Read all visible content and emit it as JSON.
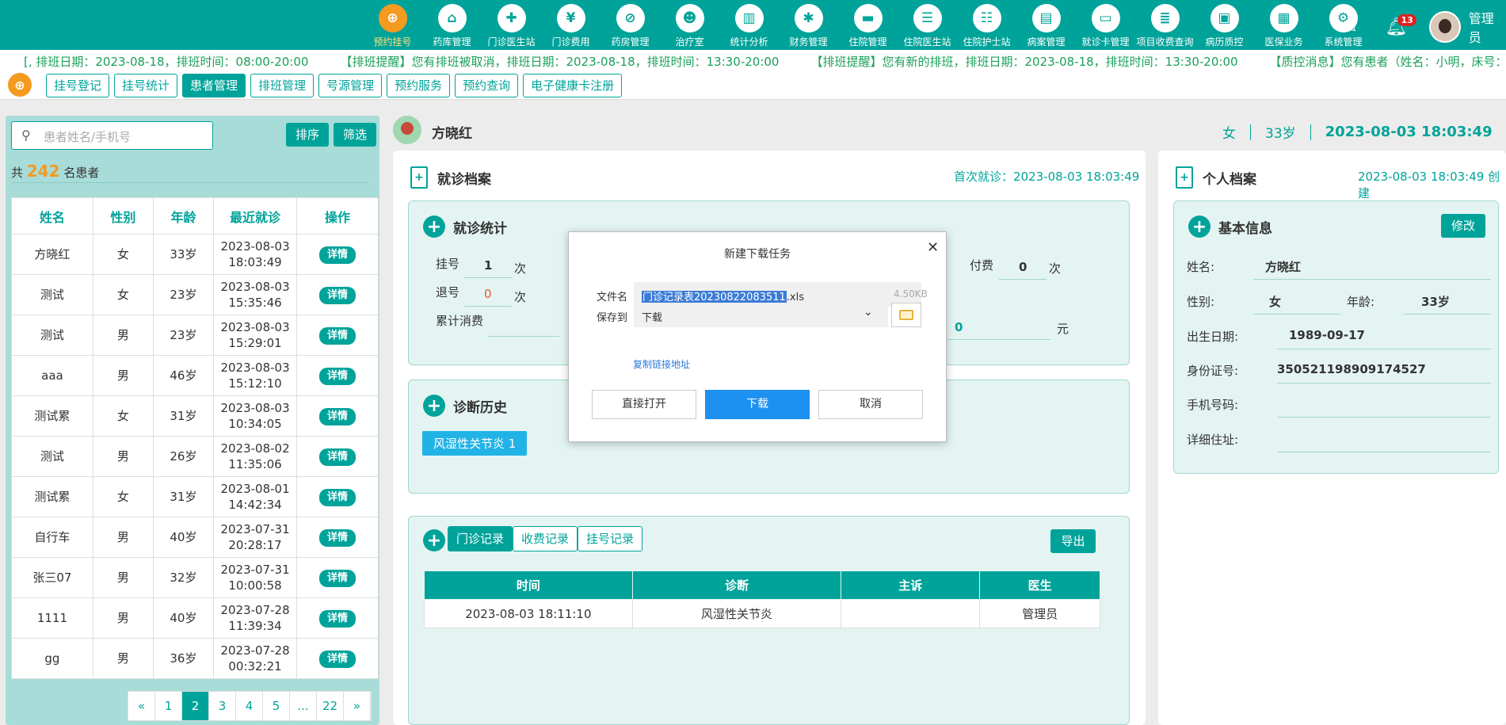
{
  "header": {
    "nav": [
      {
        "label": "预约挂号",
        "icon": "calendar-plus-icon",
        "glyph": "⊕"
      },
      {
        "label": "药库管理",
        "icon": "warehouse-icon",
        "glyph": "⌂"
      },
      {
        "label": "门诊医生站",
        "icon": "doctor-icon",
        "glyph": "✚"
      },
      {
        "label": "门诊费用",
        "icon": "yen-icon",
        "glyph": "¥"
      },
      {
        "label": "药房管理",
        "icon": "pill-icon",
        "glyph": "⊘"
      },
      {
        "label": "治疗室",
        "icon": "nurse-icon",
        "glyph": "☻"
      },
      {
        "label": "统计分析",
        "icon": "chart-icon",
        "glyph": "▥"
      },
      {
        "label": "财务管理",
        "icon": "gear-money-icon",
        "glyph": "✱"
      },
      {
        "label": "住院管理",
        "icon": "bed-icon",
        "glyph": "▬"
      },
      {
        "label": "住院医生站",
        "icon": "doctor-card-icon",
        "glyph": "☰"
      },
      {
        "label": "住院护士站",
        "icon": "nurse-card-icon",
        "glyph": "☷"
      },
      {
        "label": "病案管理",
        "icon": "folder-icon",
        "glyph": "▤"
      },
      {
        "label": "就诊卡管理",
        "icon": "card-icon",
        "glyph": "▭"
      },
      {
        "label": "项目收费查询",
        "icon": "receipt-icon",
        "glyph": "≣"
      },
      {
        "label": "病历质控",
        "icon": "record-icon",
        "glyph": "▣"
      },
      {
        "label": "医保业务",
        "icon": "insurance-icon",
        "glyph": "▦"
      },
      {
        "label": "系统管理",
        "icon": "settings-icon",
        "glyph": "⚙"
      }
    ],
    "notification_count": "13",
    "user_name": "管理员"
  },
  "ticker": [
    "[, 排班日期：2023-08-18，排班时间：08:00-20:00",
    "【排班提醒】您有排班被取消，排班日期：2023-08-18，排班时间：13:30-20:00",
    "【排班提醒】您有新的排班，排班日期：2023-08-18，排班时间：13:30-20:00",
    "【质控消息】您有患者（姓名：小明，床号：13）"
  ],
  "subtabs": [
    "挂号登记",
    "挂号统计",
    "患者管理",
    "排班管理",
    "号源管理",
    "预约服务",
    "预约查询",
    "电子健康卡注册"
  ],
  "left": {
    "search_placeholder": "患者姓名/手机号",
    "sort_label": "排序",
    "filter_label": "筛选",
    "count_prefix": "共",
    "count": "242",
    "count_suffix": "名患者",
    "columns": [
      "姓名",
      "性别",
      "年龄",
      "最近就诊",
      "操作"
    ],
    "detail_label": "详情",
    "rows": [
      {
        "name": "方晓红",
        "sex": "女",
        "age": "33岁",
        "date": "2023-08-03",
        "time": "18:03:49"
      },
      {
        "name": "测试",
        "sex": "女",
        "age": "23岁",
        "date": "2023-08-03",
        "time": "15:35:46"
      },
      {
        "name": "测试",
        "sex": "男",
        "age": "23岁",
        "date": "2023-08-03",
        "time": "15:29:01"
      },
      {
        "name": "aaa",
        "sex": "男",
        "age": "46岁",
        "date": "2023-08-03",
        "time": "15:12:10"
      },
      {
        "name": "测试累",
        "sex": "女",
        "age": "31岁",
        "date": "2023-08-03",
        "time": "10:34:05"
      },
      {
        "name": "测试",
        "sex": "男",
        "age": "26岁",
        "date": "2023-08-02",
        "time": "11:35:06"
      },
      {
        "name": "测试累",
        "sex": "女",
        "age": "31岁",
        "date": "2023-08-01",
        "time": "14:42:34"
      },
      {
        "name": "自行车",
        "sex": "男",
        "age": "40岁",
        "date": "2023-07-31",
        "time": "20:28:17"
      },
      {
        "name": "张三07",
        "sex": "男",
        "age": "32岁",
        "date": "2023-07-31",
        "time": "10:00:58"
      },
      {
        "name": "1111",
        "sex": "男",
        "age": "40岁",
        "date": "2023-07-28",
        "time": "11:39:34"
      },
      {
        "name": "gg",
        "sex": "男",
        "age": "36岁",
        "date": "2023-07-28",
        "time": "00:32:21"
      }
    ],
    "pager": [
      "«",
      "1",
      "2",
      "3",
      "4",
      "5",
      "...",
      "22",
      "»"
    ],
    "current_page": "2"
  },
  "patient": {
    "name": "方晓红",
    "sex": "女",
    "age": "33岁",
    "datetime": "2023-08-03 18:03:49"
  },
  "visit": {
    "title": "就诊档案",
    "first_visit": "首次就诊：2023-08-03 18:03:49",
    "stats_title": "就诊统计",
    "reg_label": "挂号",
    "reg_value": "1",
    "unit_times": "次",
    "refund_label": "退号",
    "refund_value": "0",
    "total_label": "累计消费",
    "paid_label": "付费",
    "paid_value": "0",
    "amount_value": "0",
    "unit_yuan": "元",
    "history_title": "诊断历史",
    "history_chip": "风湿性关节炎   1",
    "record_tabs": [
      "门诊记录",
      "收费记录",
      "挂号记录"
    ],
    "export_label": "导出",
    "table_cols": [
      "时间",
      "诊断",
      "主诉",
      "医生"
    ],
    "table_rows": [
      [
        "2023-08-03 18:11:10",
        "风湿性关节炎",
        "",
        "管理员"
      ]
    ]
  },
  "profile": {
    "title": "个人档案",
    "created": "2023-08-03 18:03:49 创建",
    "basic_title": "基本信息",
    "edit_label": "修改",
    "name_label": "姓名:",
    "name": "方晓红",
    "sex_label": "性别:",
    "sex": "女",
    "age_label": "年龄:",
    "age": "33岁",
    "birth_label": "出生日期:",
    "birth": "1989-09-17",
    "id_label": "身份证号:",
    "id": "350521198909174527",
    "phone_label": "手机号码:",
    "phone": "",
    "address_label": "详细住址:",
    "address": ""
  },
  "dialog": {
    "title": "新建下载任务",
    "filename_label": "文件名",
    "filename_selected": "门诊记录表20230822083511",
    "filename_ext": ".xls",
    "filesize": "4.50KB",
    "saveto_label": "保存到",
    "saveto_value": "下载",
    "copy_link": "复制链接地址",
    "open_label": "直接打开",
    "download_label": "下载",
    "cancel_label": "取消"
  },
  "colors": {
    "primary": "#00a39a",
    "accent": "#f39a1f",
    "danger": "#e02020",
    "download": "#1e90f0"
  }
}
